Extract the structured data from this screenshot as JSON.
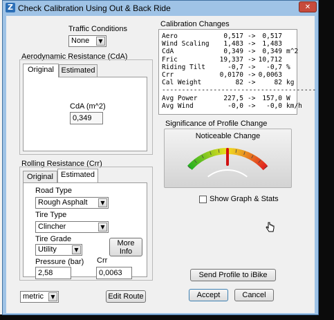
{
  "window": {
    "title": "Check Calibration Using Out & Back Ride",
    "close_glyph": "✕",
    "icon_glyph": "Z"
  },
  "traffic": {
    "label": "Traffic Conditions",
    "value": "None"
  },
  "aero": {
    "group_label": "Aerodynamic Resistance (CdA)",
    "tabs": [
      "Original",
      "Estimated"
    ],
    "cda_label": "CdA (m^2)",
    "cda_value": "0,349"
  },
  "rolling": {
    "group_label": "Rolling Resistance (Crr)",
    "tabs": [
      "Original",
      "Estimated"
    ],
    "road_type_label": "Road Type",
    "road_type_value": "Rough Asphalt",
    "tire_type_label": "Tire Type",
    "tire_type_value": "Clincher",
    "tire_grade_label": "Tire Grade",
    "tire_grade_value": "Utility",
    "more_info": [
      "More",
      "Info"
    ],
    "pressure_label": "Pressure (bar)",
    "pressure_value": "2,58",
    "crr_label": "Crr",
    "crr_value": "0,0063"
  },
  "units": {
    "value": "metric"
  },
  "buttons": {
    "edit_route": "Edit Route",
    "send_profile": "Send Profile to iBike",
    "accept": "Accept",
    "cancel": "Cancel"
  },
  "calibration_changes": {
    "label": "Calibration Changes",
    "rows": [
      {
        "name": "Aero",
        "from": "0,517",
        "arrow": "->",
        "to": "0,517",
        "unit": ""
      },
      {
        "name": "Wind Scaling",
        "from": "1,483",
        "arrow": "->",
        "to": "1,483",
        "unit": ""
      },
      {
        "name": "CdA",
        "from": "0,349",
        "arrow": "->",
        "to": "0,349",
        "unit": "m^2"
      },
      {
        "name": "Fric",
        "from": "19,337",
        "arrow": "->",
        "to": "10,712",
        "unit": ""
      },
      {
        "name": "Riding Tilt",
        "from": "-0,7",
        "arrow": "->",
        "to": "-0,7",
        "unit": "%"
      },
      {
        "name": "Crr",
        "from": "0,0170",
        "arrow": "->",
        "to": "0,0063",
        "unit": ""
      },
      {
        "name": "Cal Weight",
        "from": "82",
        "arrow": "->",
        "to": "82",
        "unit": "kg"
      }
    ],
    "separator": "---------------------------------------",
    "summary": [
      {
        "name": "Avg Power",
        "from": "227,5",
        "arrow": "->",
        "to": "157,0",
        "unit": "W"
      },
      {
        "name": "Avg Wind",
        "from": "-0,0",
        "arrow": "->",
        "to": "-0,0",
        "unit": "km/h"
      }
    ]
  },
  "significance": {
    "label": "Significance of Profile Change",
    "gauge_title": "Noticeable Change",
    "gauge_level": 0.5,
    "colors": {
      "green": "#22b022",
      "yellow": "#f0e020",
      "red": "#e02020"
    }
  },
  "show_graph": {
    "label": "Show Graph & Stats",
    "checked": false
  },
  "cursor": {
    "icon": "hand-pointer-icon"
  }
}
